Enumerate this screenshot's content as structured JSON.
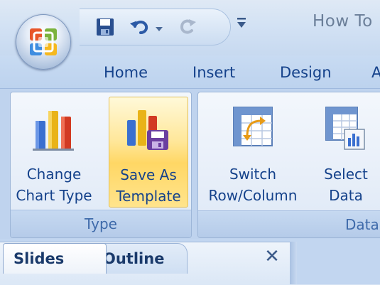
{
  "title_bar": {
    "window_title": "How To",
    "quick_access": {
      "save_icon": "save-icon",
      "undo_icon": "undo-icon",
      "undo_dropdown_icon": "chevron-down-icon",
      "redo_icon": "redo-icon",
      "customize_icon": "customize-dropdown-icon"
    }
  },
  "office_button": {
    "icon": "office-logo-icon"
  },
  "ribbon": {
    "tabs": [
      {
        "label": "Home"
      },
      {
        "label": "Insert"
      },
      {
        "label": "Design"
      },
      {
        "label": "A"
      }
    ],
    "groups": [
      {
        "label": "Type",
        "buttons": [
          {
            "label": "Change\nChart Type",
            "icon": "bar-chart-icon"
          },
          {
            "label": "Save As\nTemplate",
            "icon": "save-as-template-icon",
            "highlighted": true
          }
        ]
      },
      {
        "label": "Data",
        "buttons": [
          {
            "label": "Switch\nRow/Column",
            "icon": "switch-row-column-icon"
          },
          {
            "label": "Select\nData",
            "icon": "select-data-icon"
          }
        ]
      }
    ]
  },
  "pane": {
    "tabs": [
      {
        "label": "Slides",
        "active": true
      },
      {
        "label": "Outline",
        "active": false
      }
    ],
    "close_icon": "close-icon",
    "close_glyph": "✕"
  },
  "colors": {
    "ribbon_text": "#15428b",
    "group_label_text": "#3e6aaa",
    "highlight": "#ffd765"
  }
}
